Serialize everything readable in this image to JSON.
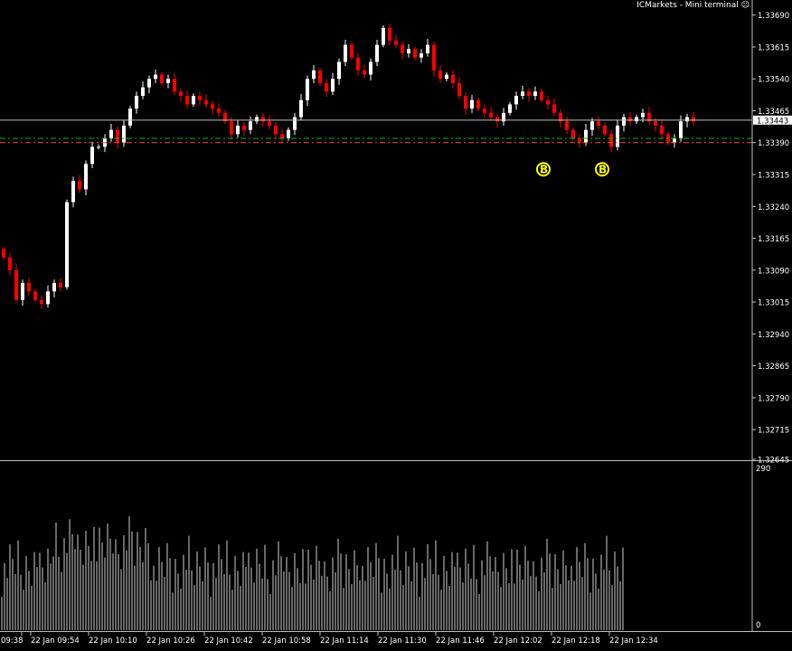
{
  "header": {
    "title": "ICMarkets - Mini terminal",
    "icon": "smiley-icon"
  },
  "colors": {
    "background": "#000000",
    "bull": "#ffffff",
    "bear": "#ff0000",
    "grid": "#c0c0c0",
    "price_line": "#c0c0c0",
    "green_level": "#00c000",
    "red_level": "#ff4040",
    "badge": "#ffff00"
  },
  "price_axis": {
    "labels": [
      "1.33690",
      "1.33615",
      "1.33540",
      "1.33465",
      "1.33390",
      "1.33315",
      "1.33240",
      "1.33165",
      "1.33090",
      "1.33015",
      "1.32940",
      "1.32865",
      "1.32790",
      "1.32715",
      "1.32645"
    ],
    "current_price": "1.33443"
  },
  "volume_axis": {
    "labels": [
      "290",
      "0"
    ]
  },
  "time_axis": {
    "labels": [
      "09:38",
      "22 Jan 09:54",
      "22 Jan 10:10",
      "22 Jan 10:26",
      "22 Jan 10:42",
      "22 Jan 10:58",
      "22 Jan 11:14",
      "22 Jan 11:30",
      "22 Jan 11:46",
      "22 Jan 12:02",
      "22 Jan 12:18",
      "22 Jan 12:34"
    ]
  },
  "badges": [
    {
      "label": "B",
      "time": "22 Jan 12:08",
      "price": 1.33355
    },
    {
      "label": "B",
      "time": "22 Jan 12:24",
      "price": 1.33355
    }
  ],
  "chart_data": {
    "type": "candlestick",
    "title": "",
    "ylim": [
      1.32645,
      1.337
    ],
    "volume_ylim": [
      0,
      290
    ],
    "levels": [
      {
        "price": 1.33443,
        "style": "solid",
        "color": "#c0c0c0"
      },
      {
        "price": 1.334,
        "style": "dash-dot",
        "color": "#00c000"
      },
      {
        "price": 1.3339,
        "style": "dash-dot",
        "color": "#ff4040"
      }
    ],
    "close": [
      1.3312,
      1.3309,
      1.3302,
      1.3306,
      1.3304,
      1.3302,
      1.3301,
      1.3304,
      1.3306,
      1.3305,
      1.3325,
      1.333,
      1.3328,
      1.3334,
      1.3338,
      1.3338,
      1.334,
      1.3342,
      1.3339,
      1.3343,
      1.3347,
      1.335,
      1.3352,
      1.3354,
      1.3355,
      1.3353,
      1.3354,
      1.3351,
      1.335,
      1.3348,
      1.335,
      1.3349,
      1.3348,
      1.3347,
      1.3346,
      1.3344,
      1.3341,
      1.3343,
      1.3342,
      1.3344,
      1.3345,
      1.3344,
      1.3343,
      1.3341,
      1.334,
      1.3342,
      1.3345,
      1.3349,
      1.3354,
      1.3356,
      1.3353,
      1.3351,
      1.3354,
      1.3358,
      1.3362,
      1.3359,
      1.3356,
      1.3355,
      1.3358,
      1.3362,
      1.3366,
      1.3363,
      1.3362,
      1.336,
      1.3361,
      1.3359,
      1.336,
      1.3362,
      1.3356,
      1.3354,
      1.3355,
      1.3353,
      1.335,
      1.3347,
      1.3349,
      1.3347,
      1.3346,
      1.3345,
      1.3344,
      1.3346,
      1.3348,
      1.335,
      1.3351,
      1.335,
      1.3351,
      1.3349,
      1.3348,
      1.3346,
      1.3344,
      1.3342,
      1.334,
      1.3339,
      1.3342,
      1.3344,
      1.3343,
      1.3341,
      1.3338,
      1.3343,
      1.3345,
      1.3344,
      1.3345,
      1.3346,
      1.3344,
      1.3343,
      1.3341,
      1.3339,
      1.334,
      1.3344,
      1.3345,
      1.3344
    ]
  }
}
